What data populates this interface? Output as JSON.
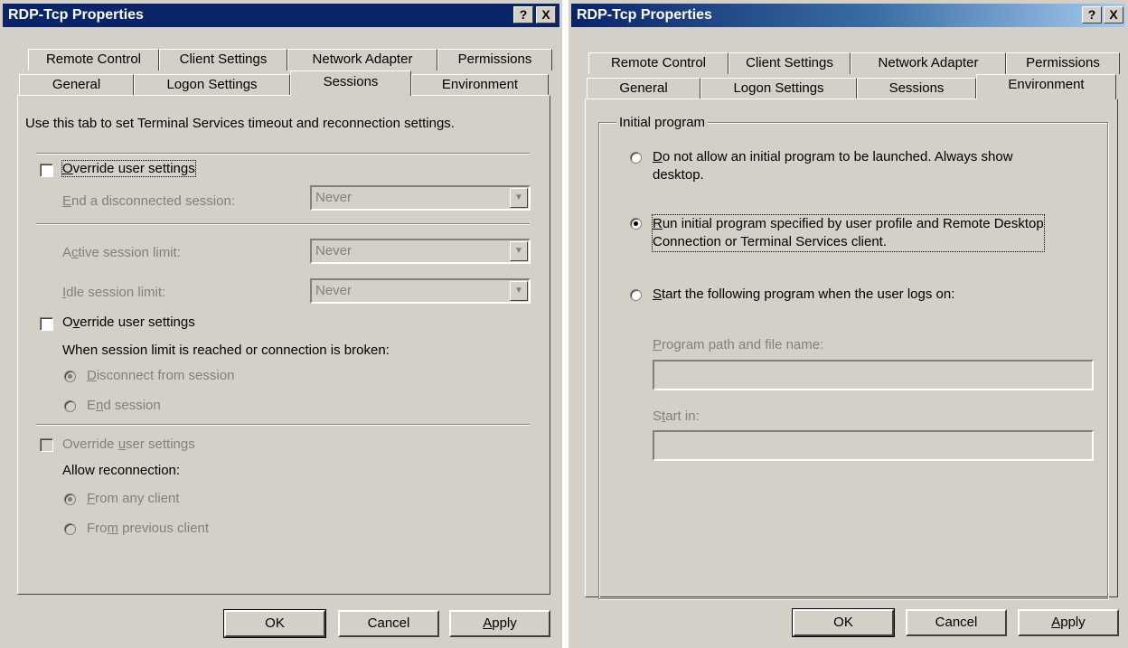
{
  "sessions_dialog": {
    "title": "RDP-Tcp Properties",
    "help_btn": "?",
    "close_btn": "X",
    "tabs_back": [
      "Remote Control",
      "Client Settings",
      "Network Adapter",
      "Permissions"
    ],
    "tabs_front": [
      "General",
      "Logon Settings",
      "Sessions",
      "Environment"
    ],
    "active_tab": "Sessions",
    "description": "Use this tab to set Terminal Services timeout and reconnection settings.",
    "override1": {
      "u": "O",
      "rest": "verride user settings",
      "checked": false
    },
    "end_disconnected": {
      "u": "E",
      "rest": "nd a disconnected session:",
      "value": "Never"
    },
    "active_limit": {
      "pre": "A",
      "u": "c",
      "rest": "tive session limit:",
      "value": "Never"
    },
    "idle_limit": {
      "u": "I",
      "rest": "dle session limit:",
      "value": "Never"
    },
    "override2": {
      "pre": "O",
      "u": "v",
      "rest": "erride user settings",
      "checked": false
    },
    "limit_reached_label": "When session limit is reached or connection is broken:",
    "disconnect_radio": {
      "u": "D",
      "rest": "isconnect from session",
      "selected": true
    },
    "end_session_radio": {
      "pre": "E",
      "u": "n",
      "rest": "d session",
      "selected": false
    },
    "override3": {
      "pre": "Override ",
      "u": "u",
      "rest": "ser settings",
      "checked": false
    },
    "allow_reconnection_label": "Allow reconnection:",
    "any_client_radio": {
      "u": "F",
      "rest": "rom any client",
      "selected": true
    },
    "previous_client_radio": {
      "pre": "Fro",
      "u": "m",
      "rest": " previous client",
      "selected": false
    },
    "ok": "OK",
    "cancel": "Cancel",
    "apply": {
      "u": "A",
      "rest": "pply"
    }
  },
  "environment_dialog": {
    "title": "RDP-Tcp Properties",
    "help_btn": "?",
    "close_btn": "X",
    "tabs_back": [
      "Remote Control",
      "Client Settings",
      "Network Adapter",
      "Permissions"
    ],
    "tabs_front": [
      "General",
      "Logon Settings",
      "Sessions",
      "Environment"
    ],
    "active_tab": "Environment",
    "group_label": "Initial program",
    "option1": {
      "u": "D",
      "rest": "o not allow an initial program to be launched. Always show",
      "line2": "desktop.",
      "selected": false
    },
    "option2": {
      "u": "R",
      "rest": "un initial program specified by user profile and Remote Desktop",
      "line2": "Connection or Terminal Services client.",
      "selected": true
    },
    "option3": {
      "u": "S",
      "rest": "tart the following program when the user logs on:",
      "selected": false
    },
    "program_path": {
      "u": "P",
      "rest": "rogram path and file name:",
      "value": ""
    },
    "start_in": {
      "pre": "S",
      "u": "t",
      "rest": "art in:",
      "value": ""
    },
    "ok": "OK",
    "cancel": "Cancel",
    "apply": {
      "u": "A",
      "rest": "pply"
    }
  }
}
